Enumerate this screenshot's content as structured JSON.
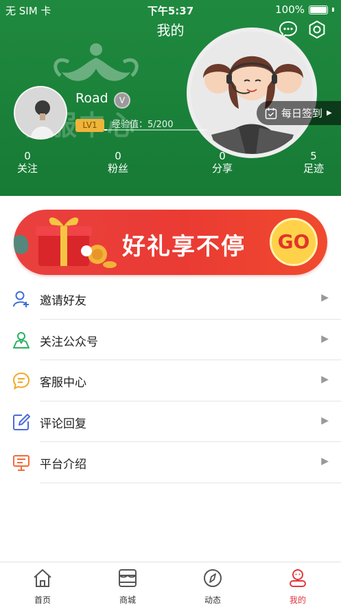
{
  "status_bar": {
    "carrier": "无 SIM 卡",
    "time": "下午5:37",
    "battery": "100%"
  },
  "header": {
    "title": "我的",
    "background_text": "客服中心",
    "username": "Road",
    "vip_badge": "V",
    "level": "LV1",
    "exp_text": "经验值：5/200",
    "exp_progress": 0.025,
    "checkin_label": "每日签到"
  },
  "stats": [
    {
      "value": "0",
      "label": "关注"
    },
    {
      "value": "0",
      "label": "粉丝"
    },
    {
      "value": "0",
      "label": "分享"
    },
    {
      "value": "5",
      "label": "足迹"
    }
  ],
  "banner": {
    "text": "好礼享不停",
    "go_label": "GO"
  },
  "menu": [
    {
      "label": "邀请好友",
      "icon": "invite-friend-icon",
      "color": "#3f6fd8"
    },
    {
      "label": "关注公众号",
      "icon": "follow-account-icon",
      "color": "#27b061"
    },
    {
      "label": "客服中心",
      "icon": "customer-service-icon",
      "color": "#f5a623"
    },
    {
      "label": "评论回复",
      "icon": "comment-reply-icon",
      "color": "#4a6cd8"
    },
    {
      "label": "平台介绍",
      "icon": "platform-intro-icon",
      "color": "#f26b3a"
    }
  ],
  "tabs": [
    {
      "label": "首页",
      "icon": "home-icon"
    },
    {
      "label": "商城",
      "icon": "shop-icon"
    },
    {
      "label": "动态",
      "icon": "compass-icon"
    },
    {
      "label": "我的",
      "icon": "profile-icon",
      "active": true
    }
  ],
  "colors": {
    "header_green": "#1f8a3f",
    "accent_red": "#e2353c",
    "banner_red": "#ea3b33"
  }
}
